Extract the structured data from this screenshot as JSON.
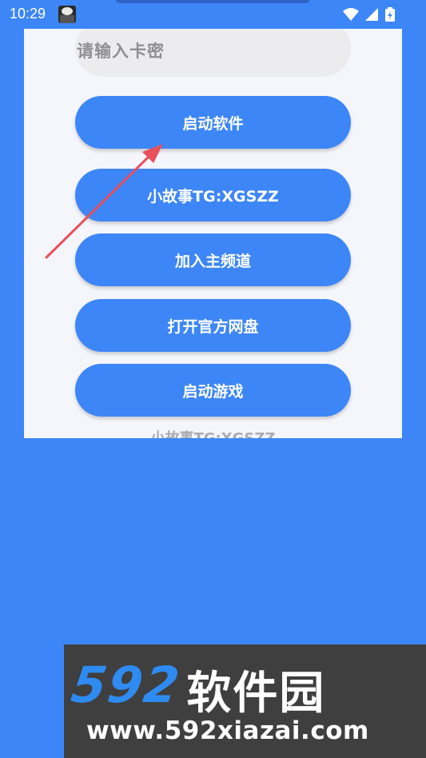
{
  "status_bar": {
    "time": "10:29",
    "app_icon": "game-avatar-icon",
    "icons": [
      "wifi-icon",
      "signal-icon",
      "battery-icon"
    ]
  },
  "form": {
    "card_input_placeholder": "请输入卡密"
  },
  "buttons": [
    {
      "id": "launch-software",
      "label": "启动软件"
    },
    {
      "id": "story-tg",
      "label": "小故事TG:XGSZZ"
    },
    {
      "id": "join-channel",
      "label": "加入主频道"
    },
    {
      "id": "open-drive",
      "label": "打开官方网盘"
    },
    {
      "id": "launch-game",
      "label": "启动游戏"
    }
  ],
  "footer": {
    "text": "小故事TG:XGSZZ"
  },
  "annotation": {
    "arrow": "red-arrow-icon",
    "color": "#E8505B"
  },
  "watermark": {
    "logo_number": "592",
    "logo_text": "软件园",
    "url": "www.592xiazai.com"
  },
  "colors": {
    "background": "#3D86F7",
    "panel": "#F5F6FB",
    "button": "#3D86F7",
    "input": "#ECECEF",
    "placeholder": "#8E8E93",
    "footer_text": "#A9ABB3",
    "watermark_blue": "#2F8BF2"
  }
}
